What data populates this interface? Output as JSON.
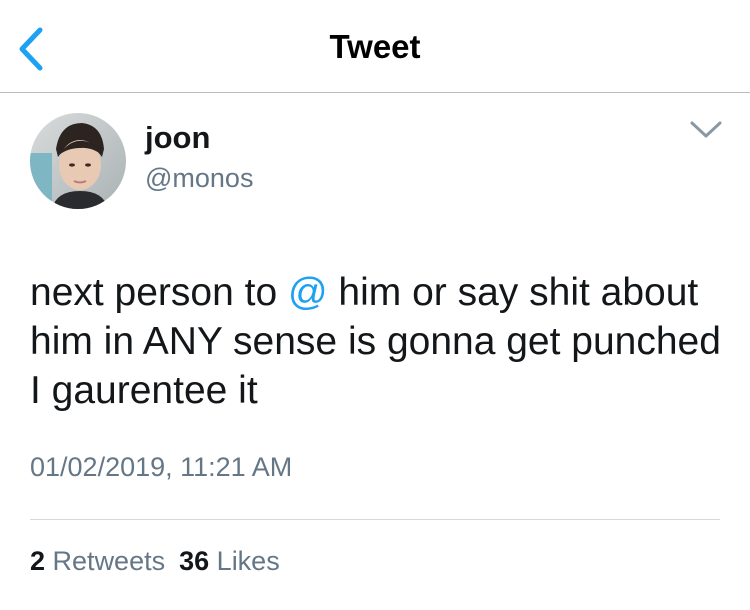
{
  "nav": {
    "title": "Tweet",
    "back_icon": "chevron-left-icon",
    "accent_color": "#1da1f2"
  },
  "tweet": {
    "author": {
      "name": "joon",
      "handle": "@monos"
    },
    "text": {
      "part1": "next person to ",
      "mention": "@",
      "part2": " him or say shit about him in ANY sense is gonna get punched I gaurentee it"
    },
    "timestamp": "01/02/2019, 11:21 AM",
    "stats": {
      "retweets_count": "2",
      "retweets_label": "Retweets",
      "likes_count": "36",
      "likes_label": "Likes"
    },
    "menu_icon": "chevron-down-icon"
  },
  "colors": {
    "text": "#14171a",
    "secondary": "#657786",
    "link": "#1da1f2",
    "divider": "#d6d9db"
  }
}
